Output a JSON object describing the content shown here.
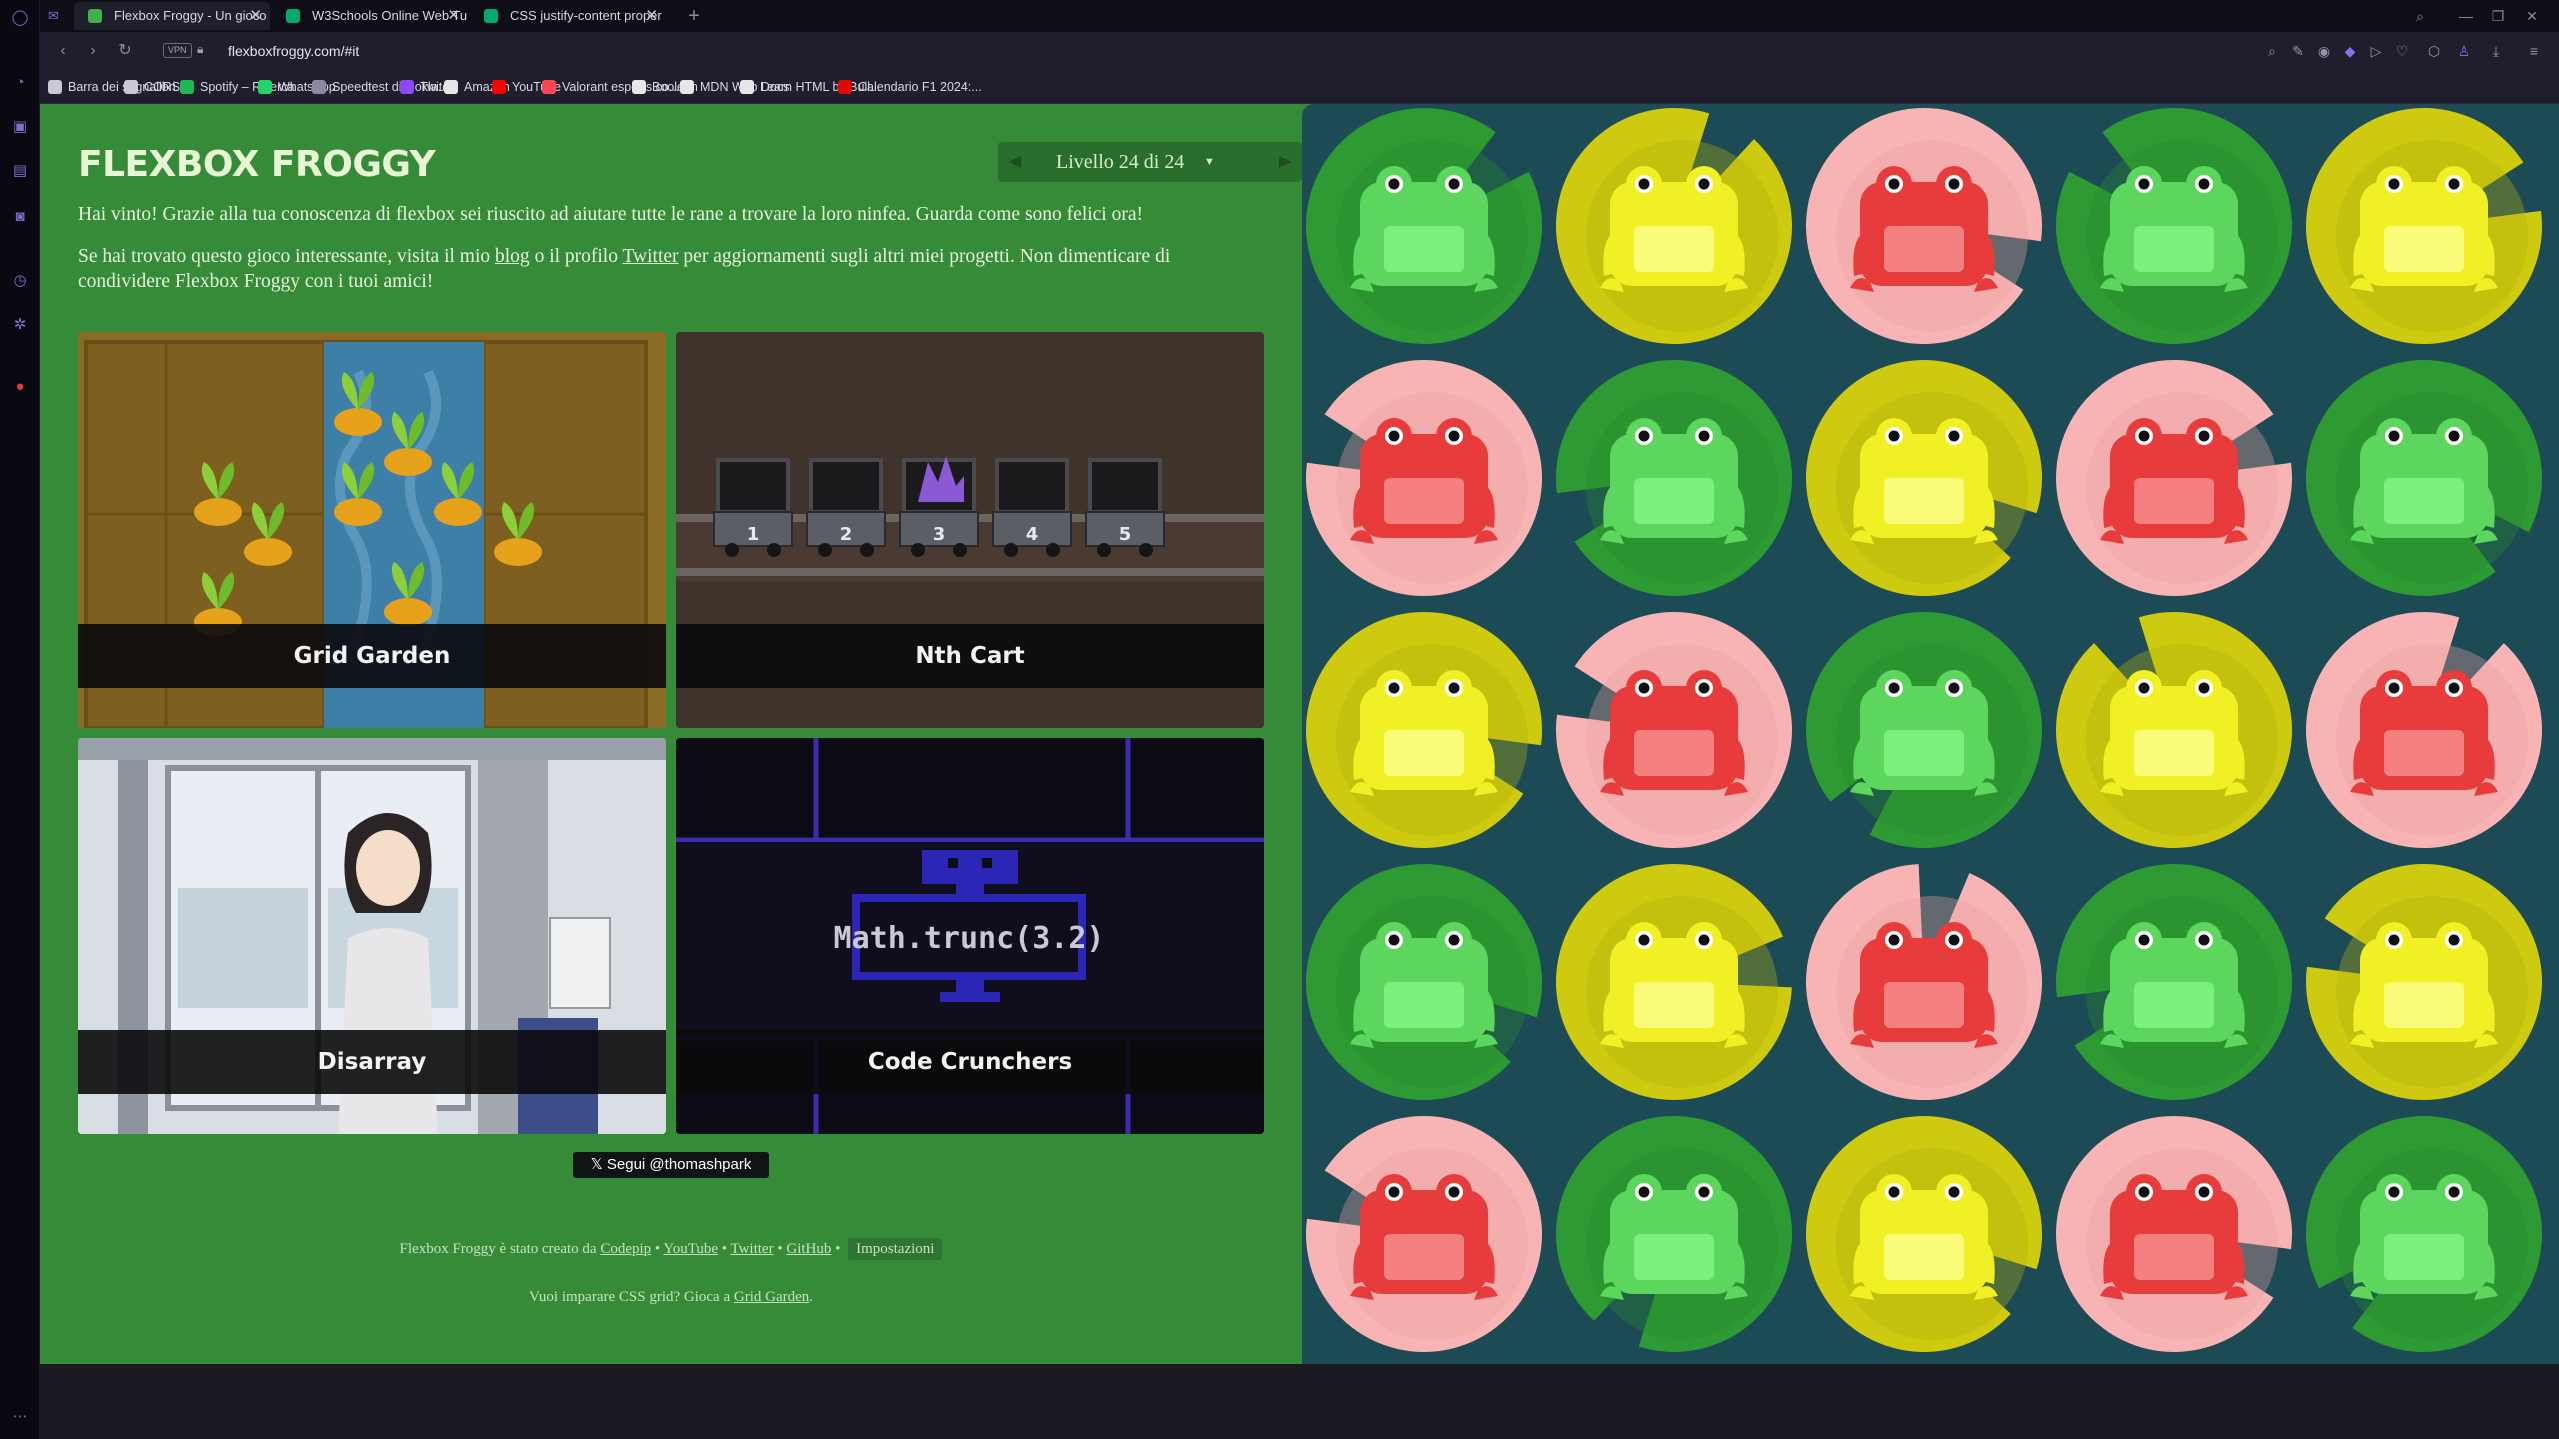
{
  "browser": {
    "tabs": [
      {
        "title": "Flexbox Froggy - Un gioco",
        "favicon_color": "#3fb04a",
        "active": true
      },
      {
        "title": "W3Schools Online Web Tu",
        "favicon_color": "#04aa6d",
        "active": false
      },
      {
        "title": "CSS justify-content proper",
        "favicon_color": "#04aa6d",
        "active": false
      }
    ],
    "vpn_label": "VPN",
    "url": "flexboxfroggy.com/#it",
    "bookmarks": [
      {
        "label": "Barra dei segnalibri...",
        "icon": "folder-icon",
        "color": "#c9c8d6"
      },
      {
        "label": "CORSO",
        "icon": "folder-icon",
        "color": "#c9c8d6"
      },
      {
        "label": "Spotify – Ricerca",
        "icon": "spotify-icon",
        "color": "#1db954"
      },
      {
        "label": "WhatsApp",
        "icon": "whatsapp-icon",
        "color": "#25d366"
      },
      {
        "label": "Speedtest di Ookla...",
        "icon": "speedtest-icon",
        "color": "#8b8aa0"
      },
      {
        "label": "Twitch",
        "icon": "twitch-icon",
        "color": "#9146ff"
      },
      {
        "label": "Amazon",
        "icon": "amazon-icon",
        "color": "#e6e6e6"
      },
      {
        "label": "YouTube",
        "icon": "youtube-icon",
        "color": "#ff0000"
      },
      {
        "label": "Valorant esports co...",
        "icon": "valorant-icon",
        "color": "#ff4655"
      },
      {
        "label": "Boolean",
        "icon": "boolean-icon",
        "color": "#e6e6e6"
      },
      {
        "label": "MDN Web Docs",
        "icon": "mdn-icon",
        "color": "#e6e6e6"
      },
      {
        "label": "Learn HTML by Buil...",
        "icon": "freecodecamp-icon",
        "color": "#e6e6e6"
      },
      {
        "label": "Calendario F1 2024:...",
        "icon": "f1-icon",
        "color": "#e10600"
      }
    ]
  },
  "game": {
    "title": "FLEXBOX FROGGY",
    "level_label": "Livello 24 di 24",
    "win_text": "Hai vinto! Grazie alla tua conoscenza di flexbox sei riuscito ad aiutare tutte le rane a trovare la loro ninfea. Guarda come sono felici ora!",
    "share_prefix": "Se hai trovato questo gioco interessante, visita il mio ",
    "share_blog": "blog",
    "share_mid": " o il profilo ",
    "share_twitter": "Twitter",
    "share_suffix": " per aggiornamenti sugli altri miei progetti. Non dimenticare di condividere Flexbox Froggy con i tuoi amici!",
    "cards": [
      {
        "label": "Grid Garden"
      },
      {
        "label": "Nth Cart",
        "cart_numbers": [
          "1",
          "2",
          "3",
          "4",
          "5"
        ]
      },
      {
        "label": "Disarray"
      },
      {
        "label": "Code Crunchers",
        "code_text": "Math.trunc(3.2)"
      }
    ],
    "follow_label": "Segui @thomashpark",
    "footer": {
      "created_prefix": "Flexbox Froggy è stato creato da ",
      "codepip": "Codepip",
      "youtube": "YouTube",
      "twitter": "Twitter",
      "github": "GitHub",
      "settings": "Impostazioni",
      "sep": " • ",
      "grid_prefix": "Vuoi imparare CSS grid? Gioca a ",
      "grid_link": "Grid Garden",
      "grid_suffix": "."
    }
  },
  "pond": {
    "colors": {
      "green": {
        "pad": "#2e9a33",
        "pad_shadow": "#258a2a",
        "frog": "#5cd65c",
        "belly": "#7cf07c"
      },
      "yellow": {
        "pad": "#cdca10",
        "pad_shadow": "#b5b30c",
        "frog": "#f0f024",
        "belly": "#fbfb7a"
      },
      "red": {
        "pad": "#f8b4b4",
        "pad_shadow": "#eba0a0",
        "frog": "#e83c3c",
        "belly": "#f58080"
      }
    },
    "rows": [
      [
        "green",
        "yellow",
        "red",
        "green",
        "yellow"
      ],
      [
        "red",
        "green",
        "yellow",
        "red",
        "green"
      ],
      [
        "yellow",
        "red",
        "green",
        "yellow",
        "red"
      ],
      [
        "green",
        "yellow",
        "red",
        "green",
        "yellow"
      ],
      [
        "red",
        "green",
        "yellow",
        "red",
        "green"
      ]
    ]
  }
}
